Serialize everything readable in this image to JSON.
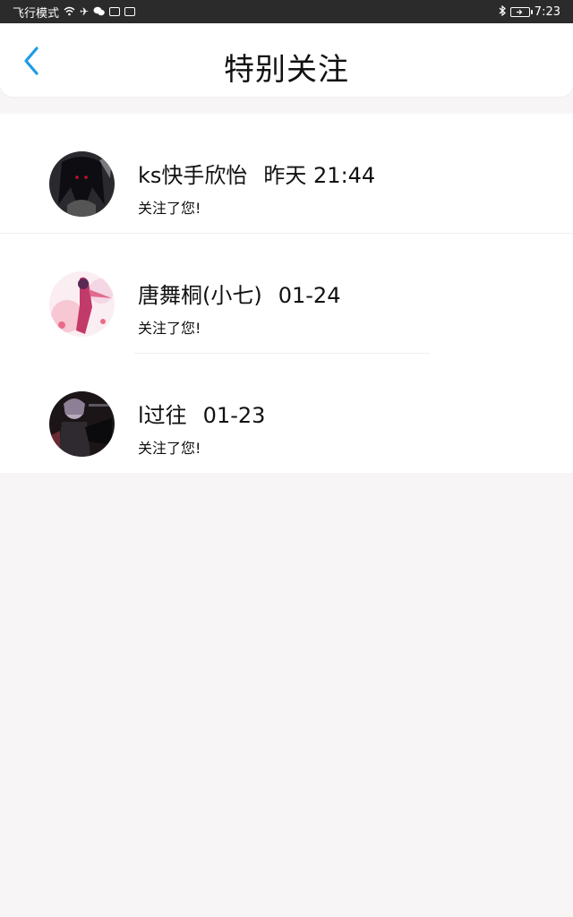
{
  "status_bar": {
    "left_text": "飞行模式",
    "time": "7:23",
    "icons": [
      "wifi-icon",
      "airplane-icon",
      "wechat-icon",
      "qq-icon",
      "mail-icon"
    ],
    "right_icons": [
      "bluetooth-icon",
      "battery-icon"
    ]
  },
  "header": {
    "title": "特别关注",
    "back_icon": "chevron-left-icon",
    "accent_color": "#1e9be8"
  },
  "follows": [
    {
      "name": "ks快手欣怡",
      "time": "昨天 21:44",
      "message": "关注了您!"
    },
    {
      "name": "唐舞桐(小七)",
      "time": "01-24",
      "message": "关注了您!"
    },
    {
      "name": "l过往",
      "time": "01-23",
      "message": "关注了您!"
    }
  ]
}
